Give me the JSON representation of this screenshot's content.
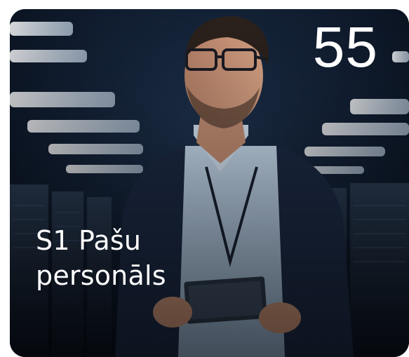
{
  "card": {
    "number": "55",
    "title_line1": "S1 Pašu",
    "title_line2": "personāls",
    "image_alt": "Man with glasses holding a tablet in a server room"
  },
  "colors": {
    "card_background": "#0c1422",
    "text": "#ffffff"
  }
}
